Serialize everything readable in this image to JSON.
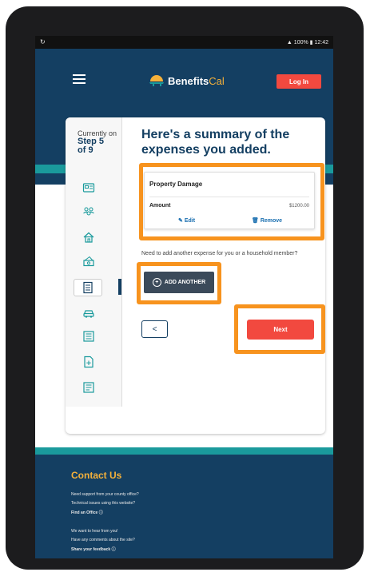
{
  "status_bar": {
    "signal": "100%",
    "time": "12:42"
  },
  "header": {
    "logo_main": "Benefits",
    "logo_accent": "Cal",
    "login_label": "Log In"
  },
  "progress": {
    "currently_on": "Currently on",
    "step_line1": "Step 5",
    "step_line2": "of 9",
    "steps": [
      "id-card",
      "people",
      "home",
      "income",
      "expenses",
      "car",
      "list",
      "document-add",
      "review"
    ],
    "active_step_index": 4
  },
  "summary": {
    "title": "Here's a summary of the expenses you added.",
    "expense": {
      "name": "Property Damage",
      "amount_label": "Amount",
      "amount_value": "$1200.00",
      "edit_label": "Edit",
      "remove_label": "Remove"
    },
    "add_prompt": "Need to add another expense for you or a household member?",
    "add_label": "ADD ANOTHER",
    "back_label": "<",
    "next_label": "Next"
  },
  "footer": {
    "title": "Contact Us",
    "line1": "Need support from your county office?",
    "line2": "Technical issues using this website?",
    "link1": "Find an Office",
    "line3": "We want to hear from you!",
    "line4": "Have any comments about the site?",
    "link2": "Share your feedback"
  },
  "colors": {
    "primary": "#143f62",
    "teal": "#1a9a9c",
    "accent_red": "#f2493f",
    "accent_gold": "#f5b13a",
    "highlight": "#f7931e"
  }
}
